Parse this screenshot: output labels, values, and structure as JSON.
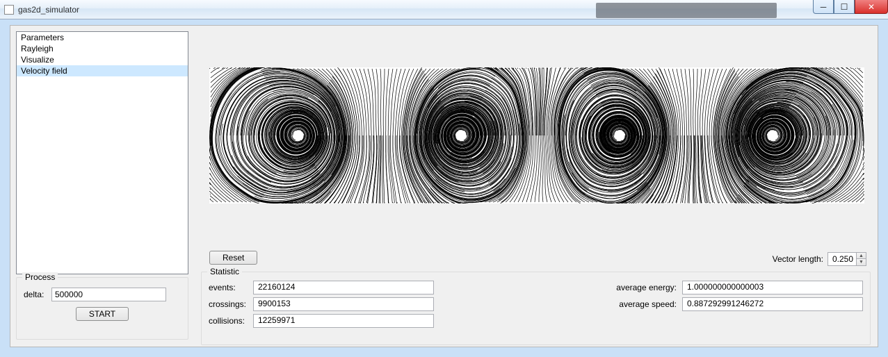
{
  "window": {
    "title": "gas2d_simulator",
    "icon_name": "app-icon"
  },
  "sidebar": {
    "items": [
      {
        "label": "Parameters"
      },
      {
        "label": "Rayleigh"
      },
      {
        "label": "Visualize"
      },
      {
        "label": "Velocity field",
        "selected": true
      }
    ]
  },
  "process": {
    "title": "Process",
    "delta_label": "delta:",
    "delta_value": "500000",
    "start_label": "START"
  },
  "controls": {
    "reset_label": "Reset",
    "vector_length_label": "Vector length:",
    "vector_length_value": "0.250"
  },
  "statistic": {
    "title": "Statistic",
    "events_label": "events:",
    "events_value": "22160124",
    "crossings_label": "crossings:",
    "crossings_value": "9900153",
    "collisions_label": "collisions:",
    "collisions_value": "12259971",
    "avg_energy_label": "average energy:",
    "avg_energy_value": "1.000000000000003",
    "avg_speed_label": "average speed:",
    "avg_speed_value": "0.887292991246272"
  },
  "visualization": {
    "type": "velocity_field_streamlines",
    "vortex_count": 4,
    "description": "Four convective roll vortices (Rayleigh-Bénard-like) rendered as dense black streamlines on white"
  }
}
